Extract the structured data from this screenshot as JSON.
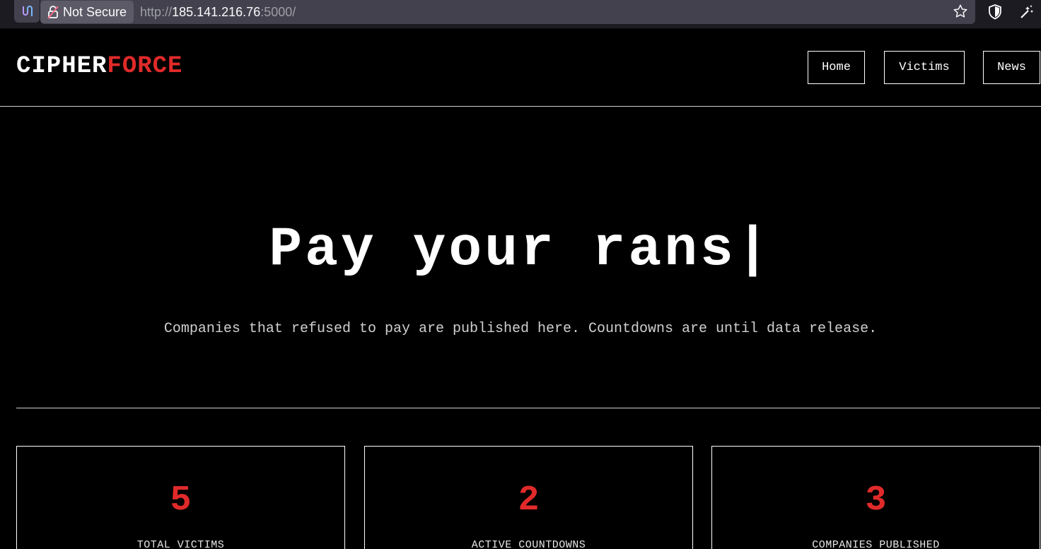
{
  "browser": {
    "security_label": "Not Secure",
    "url_scheme": "http://",
    "url_host": "185.141.216.76",
    "url_rest": ":5000/"
  },
  "site": {
    "logo_primary": "CIPHER",
    "logo_accent": "FORCE",
    "accent_color": "#e02a2a"
  },
  "nav": {
    "items": [
      {
        "label": "Home"
      },
      {
        "label": "Victims"
      },
      {
        "label": "News"
      }
    ]
  },
  "hero": {
    "title": "Pay your rans|",
    "subtitle": "Companies that refused to pay are published here. Countdowns are until data release."
  },
  "stats": [
    {
      "value": "5",
      "label": "TOTAL VICTIMS"
    },
    {
      "value": "2",
      "label": "ACTIVE COUNTDOWNS"
    },
    {
      "value": "3",
      "label": "COMPANIES PUBLISHED"
    }
  ]
}
